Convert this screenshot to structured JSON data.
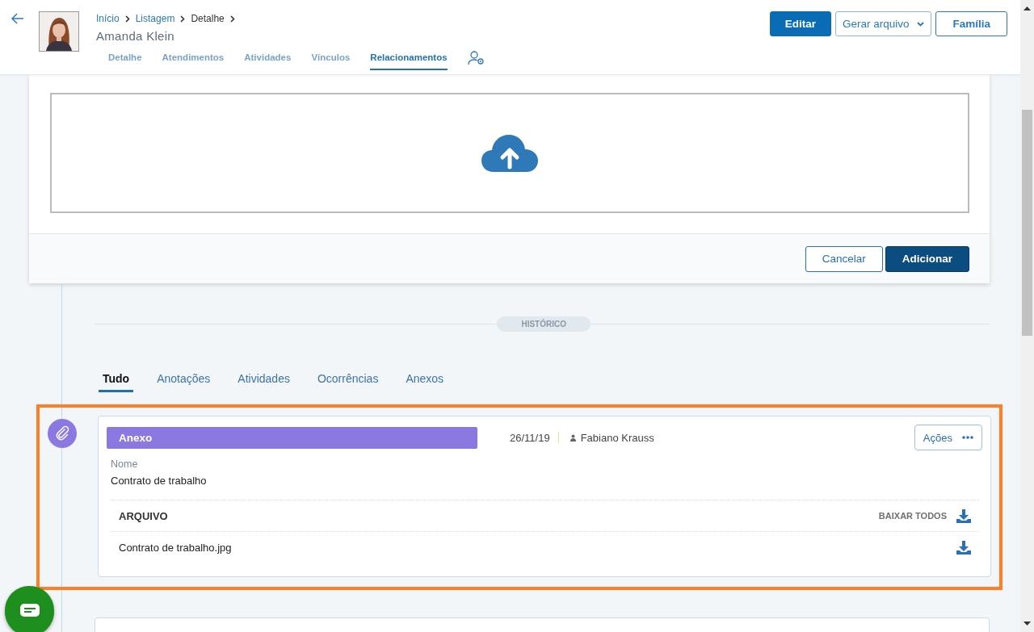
{
  "header": {
    "breadcrumb": [
      {
        "label": "Início",
        "link": true
      },
      {
        "label": "Listagem",
        "link": true
      },
      {
        "label": "Detalhe",
        "link": false
      }
    ],
    "name": "Amanda Klein",
    "tabs": [
      {
        "label": "Detalhe",
        "selected": false
      },
      {
        "label": "Atendimentos",
        "selected": false
      },
      {
        "label": "Atividades",
        "selected": false
      },
      {
        "label": "Vínculos",
        "selected": false
      },
      {
        "label": "Relacionamentos",
        "selected": true
      }
    ],
    "buttons": [
      {
        "label": "Editar",
        "kind": "primary"
      },
      {
        "label": "Gerar arquivo",
        "kind": "dropdown"
      },
      {
        "label": "Família",
        "kind": "outline"
      }
    ]
  },
  "upload": {
    "buttons": [
      {
        "label": "Cancelar",
        "kind": "outline"
      },
      {
        "label": "Adicionar",
        "kind": "primary"
      }
    ]
  },
  "history": {
    "label": "HISTÓRICO",
    "tabs": [
      {
        "label": "Tudo",
        "selected": true
      },
      {
        "label": "Anotações",
        "selected": false
      },
      {
        "label": "Atividades",
        "selected": false
      },
      {
        "label": "Ocorrências",
        "selected": false
      },
      {
        "label": "Anexos",
        "selected": false
      }
    ]
  },
  "entry": {
    "type": "Anexo",
    "date": "26/11/19",
    "author": "Fabiano Krauss",
    "actions": "Ações",
    "field_label": "Nome",
    "field_value": "Contrato de trabalho",
    "files_heading": "ARQUIVO",
    "download_all": "BAIXAR TODOS",
    "files": [
      "Contrato de trabalho.jpg"
    ]
  }
}
